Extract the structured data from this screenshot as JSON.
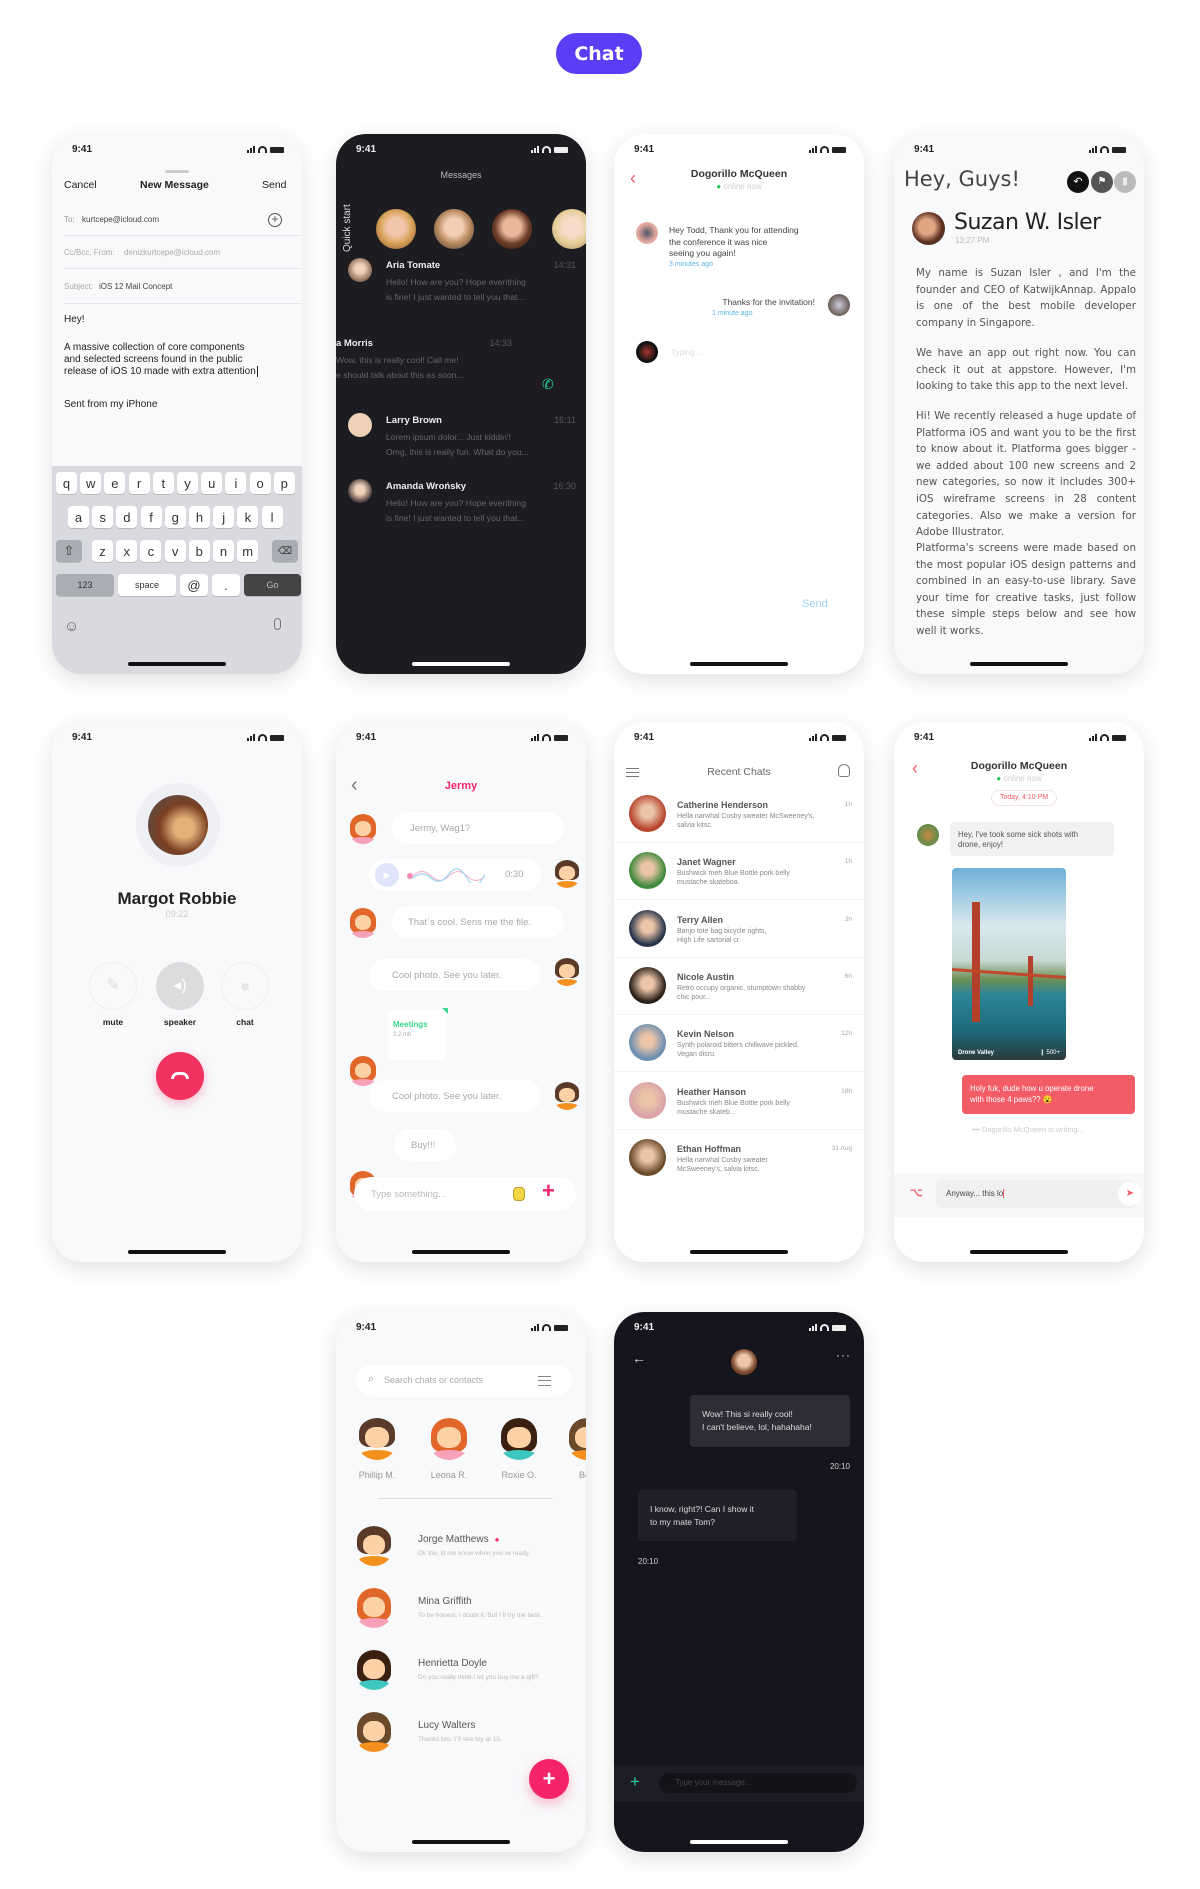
{
  "page_title": "Chat",
  "status_time": "9:41",
  "colors": {
    "accent_purple": "#5b3df5",
    "pink": "#f5246a",
    "coral": "#f25c66",
    "green": "#22d39a",
    "link_blue": "#5ab4e8",
    "hangup": "#f0325f"
  },
  "mail": {
    "cancel": "Cancel",
    "title": "New Message",
    "send": "Send",
    "to_label": "To:",
    "to_value": "kurtcepe@icloud.com",
    "cc_label": "Cc/Bcc, From:",
    "cc_value": "denizkurtcepe@icloud.com",
    "subject_label": "Subject:",
    "subject_value": "iOS 12 Mail Concept",
    "greeting": "Hey!",
    "body_lines": [
      "A massive collection of core components",
      "and selected screens found in the public",
      "release of iOS 10 made with extra attention"
    ],
    "signature": "Sent from my iPhone",
    "keys_row1": [
      "q",
      "w",
      "e",
      "r",
      "t",
      "y",
      "u",
      "i",
      "o",
      "p"
    ],
    "keys_row2": [
      "a",
      "s",
      "d",
      "f",
      "g",
      "h",
      "j",
      "k",
      "l"
    ],
    "keys_row3": [
      "z",
      "x",
      "c",
      "v",
      "b",
      "n",
      "m"
    ],
    "key_123": "123",
    "key_space": "space",
    "key_at": "@",
    "key_dot": ".",
    "key_go": "Go"
  },
  "messages_dark": {
    "title": "Messages",
    "quick_start": "Quick start",
    "items": [
      {
        "name": "Aria Tomate",
        "time": "14:31",
        "line1": "Hello! How are you? Hope everithing",
        "line2": "is fine! I just wanted to tell you that..."
      },
      {
        "name": "a Morris",
        "time": "14:33",
        "line1": "Wow, this is really cool! Call me!",
        "line2": "e should talk about this as soon..."
      },
      {
        "name": "Larry Brown",
        "time": "16:11",
        "line1": "Lorem ipsum dolor... Just kiddin'!",
        "line2": "Omg, this is really fun. What do you..."
      },
      {
        "name": "Amanda Wrońsky",
        "time": "16:30",
        "line1": "Hello! How are you? Hope everithing",
        "line2": "is fine! I just wanted to tell you that..."
      }
    ]
  },
  "chat_simple": {
    "name": "Dogorillo McQueen",
    "status": "online now",
    "msg1_lines": [
      "Hey Todd, Thank you for attending",
      "the conference it was nice",
      "seeing you again!"
    ],
    "msg1_time": "3 minutes ago",
    "msg2": "Thanks for the invitation!",
    "msg2_time": "1 minute ago",
    "typing": "Typing ...",
    "send": "Send"
  },
  "email_read": {
    "greeting": "Hey, Guys!",
    "sender": "Suzan W. Isler",
    "time": "13:27 PM",
    "p1": "My name is Suzan Isler , and I'm the founder and CEO of KatwijkAnnap. Appalo is one of the best mobile developer company in Singapore.",
    "p2": "We have an app out right now. You can check it out at appstore. However, I'm looking to take this app to the next level.",
    "p3": "Hi! We recently released a huge update of Platforma iOS and want you to be the first to know about it. Platforma goes bigger - we added about 100 new screens and 2 new categories, so now it includes 300+ iOS wireframe screens in 28 content categories. Also we make a version for Adobe Illustrator.",
    "p4": "Platforma's screens were made based on the most popular iOS design patterns and combined in an easy-to-use library. Save your time for creative tasks, just follow these simple steps below and see how well it works."
  },
  "call": {
    "name": "Margot Robbie",
    "duration": "09:22",
    "mute": "mute",
    "speaker": "speaker",
    "chat": "chat"
  },
  "jermy": {
    "title": "Jermy",
    "m1": "Jermy, Wag1?",
    "voice_duration": "0:30",
    "m3": "That`s cool. Sens me the file.",
    "m4": "Cool photo.  See you later.",
    "file_name": "Meetings",
    "file_size": "2.2 mb",
    "m6": "Cool photo.  See you later.",
    "m7": "Buy!!!",
    "input_placeholder": "Type something..."
  },
  "recent": {
    "title": "Recent Chats",
    "items": [
      {
        "name": "Catherine Henderson",
        "time": "1h",
        "l1": "Hella narwhal Cosby sweater McSweeney's,",
        "l2": "salvia kitsc."
      },
      {
        "name": "Janet Wagner",
        "time": "1h",
        "l1": "Bushwick meh Blue Bottle pork belly",
        "l2": "mustache skateboa."
      },
      {
        "name": "Terry Allen",
        "time": "3h",
        "l1": "Banjo tote bag bicycle rights,",
        "l2": "High Life sartorial cr."
      },
      {
        "name": "Nicole Austin",
        "time": "6h",
        "l1": "Retro occupy organic, stumptown shabby",
        "l2": "chic pour..."
      },
      {
        "name": "Kevin Nelson",
        "time": "12h",
        "l1": "Synth polaroid bitters chillwave pickled.",
        "l2": "Vegan disru."
      },
      {
        "name": "Heather Hanson",
        "time": "18h",
        "l1": "Bushwick meh Blue Bottle pork belly",
        "l2": "mustache skateb..."
      },
      {
        "name": "Ethan Hoffman",
        "time": "31 Aug",
        "l1": "Hella narwhal Cosby sweater",
        "l2": "McSweeney's, salvia kitsc."
      }
    ]
  },
  "drone": {
    "name": "Dogorillo McQueen",
    "status": "online now",
    "date_pill": "Today, 4:10 PM",
    "msg1_lines": [
      "Hey, I've took some sick shots with",
      "drone, enjoy!"
    ],
    "photo_caption": "Drone Valley",
    "photo_likes": "500+",
    "reply_lines": [
      "Holy fuk, dude how u operate drone",
      "with those 4 paws?? 😮"
    ],
    "writing": "Dogorillo McQueen is writing...",
    "input_value": "Anyway... this lo"
  },
  "contacts": {
    "search_placeholder": "Search chats or contacts",
    "favorites": [
      "Phillip M.",
      "Leona R.",
      "Roxie O.",
      "Bett"
    ],
    "items": [
      {
        "name": "Jorge Matthews",
        "msg": "Ok the, lit me know when you`re ready.",
        "unread": true
      },
      {
        "name": "Mina Griffith",
        "msg": "To  be honest, I doubt it. But I`ll try me best."
      },
      {
        "name": "Henrietta Doyle",
        "msg": "Do you really think I let you buy me a gift?"
      },
      {
        "name": "Lucy Walters",
        "msg": "Thanks bro. I`ll see toy at 10."
      }
    ]
  },
  "dark_chat": {
    "m1_lines": [
      "Wow! This si really cool!",
      "I can't believe, lol, hahahaha!"
    ],
    "m1_time": "20:10",
    "m2_lines": [
      "I know, right?! Can I show it",
      "to my mate Tom?"
    ],
    "m2_time": "20:10",
    "input_placeholder": "Type your message..."
  }
}
